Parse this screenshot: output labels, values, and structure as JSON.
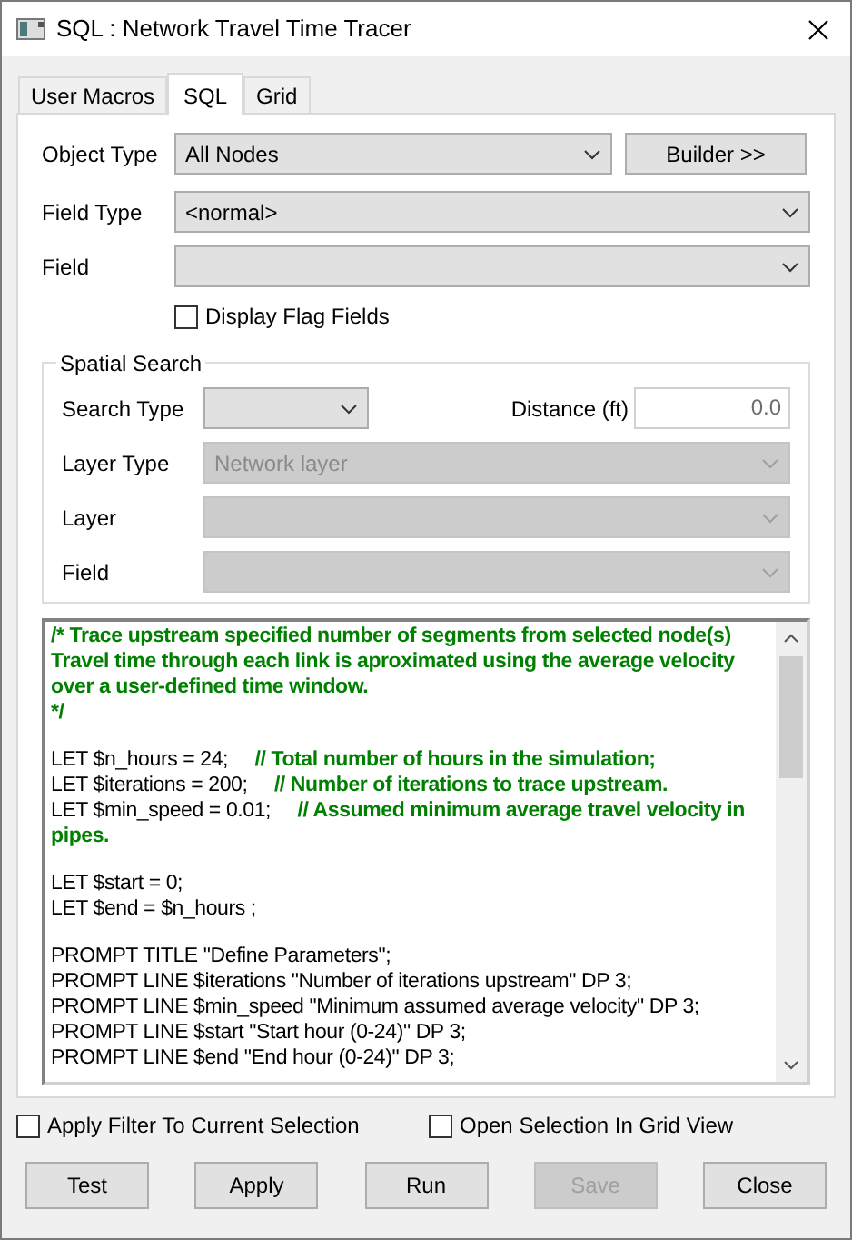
{
  "window": {
    "title": "SQL : Network Travel Time Tracer"
  },
  "tabs": [
    {
      "label": "User Macros",
      "selected": false
    },
    {
      "label": "SQL",
      "selected": true
    },
    {
      "label": "Grid",
      "selected": false
    }
  ],
  "object_type": {
    "label": "Object Type",
    "value": "All Nodes"
  },
  "builder_button": "Builder >>",
  "field_type": {
    "label": "Field Type",
    "value": "<normal>"
  },
  "field": {
    "label": "Field"
  },
  "display_flag_fields": {
    "label": "Display Flag Fields",
    "checked": false
  },
  "spatial_search": {
    "title": "Spatial Search",
    "search_type": {
      "label": "Search Type",
      "disabled": false
    },
    "distance": {
      "label": "Distance (ft)",
      "value": "0.0"
    },
    "layer_type": {
      "label": "Layer Type",
      "value": "Network layer",
      "disabled": true
    },
    "layer": {
      "label": "Layer",
      "disabled": true
    },
    "field": {
      "label": "Field",
      "disabled": true
    }
  },
  "sql_blocks": [
    [
      {
        "comment": "/* Trace upstream specified number of segments from selected node(s)"
      },
      {
        "comment": "Travel time through each link is aproximated using the average velocity"
      },
      {
        "comment": "over a user-defined time window."
      },
      {
        "comment": "*/"
      }
    ],
    [
      {
        "code": "LET $n_hours = 24;",
        "comment": "// Total number of hours in the simulation;"
      },
      {
        "code": "LET $iterations = 200;",
        "comment": "// Number of iterations to trace upstream."
      },
      {
        "code": "LET $min_speed = 0.01;",
        "comment": "// Assumed minimum average travel velocity in pipes."
      }
    ],
    [
      {
        "code": "LET $start = 0;"
      },
      {
        "code": "LET $end = $n_hours ;"
      }
    ],
    [
      {
        "code": "PROMPT TITLE \"Define Parameters\";"
      },
      {
        "code": "PROMPT LINE $iterations \"Number of iterations upstream\" DP 3;"
      },
      {
        "code": "PROMPT LINE $min_speed \"Minimum assumed average velocity\" DP 3;"
      },
      {
        "code": "PROMPT LINE $start \"Start hour (0-24)\" DP 3;"
      },
      {
        "code": "PROMPT LINE $end \"End hour (0-24)\" DP 3;"
      }
    ]
  ],
  "options": [
    {
      "label": "Apply Filter To Current Selection",
      "checked": false
    },
    {
      "label": "Open Selection In Grid View",
      "checked": false
    }
  ],
  "buttons": [
    {
      "label": "Test",
      "disabled": false
    },
    {
      "label": "Apply",
      "disabled": false
    },
    {
      "label": "Run",
      "disabled": false
    },
    {
      "label": "Save",
      "disabled": true
    },
    {
      "label": "Close",
      "disabled": false
    }
  ]
}
